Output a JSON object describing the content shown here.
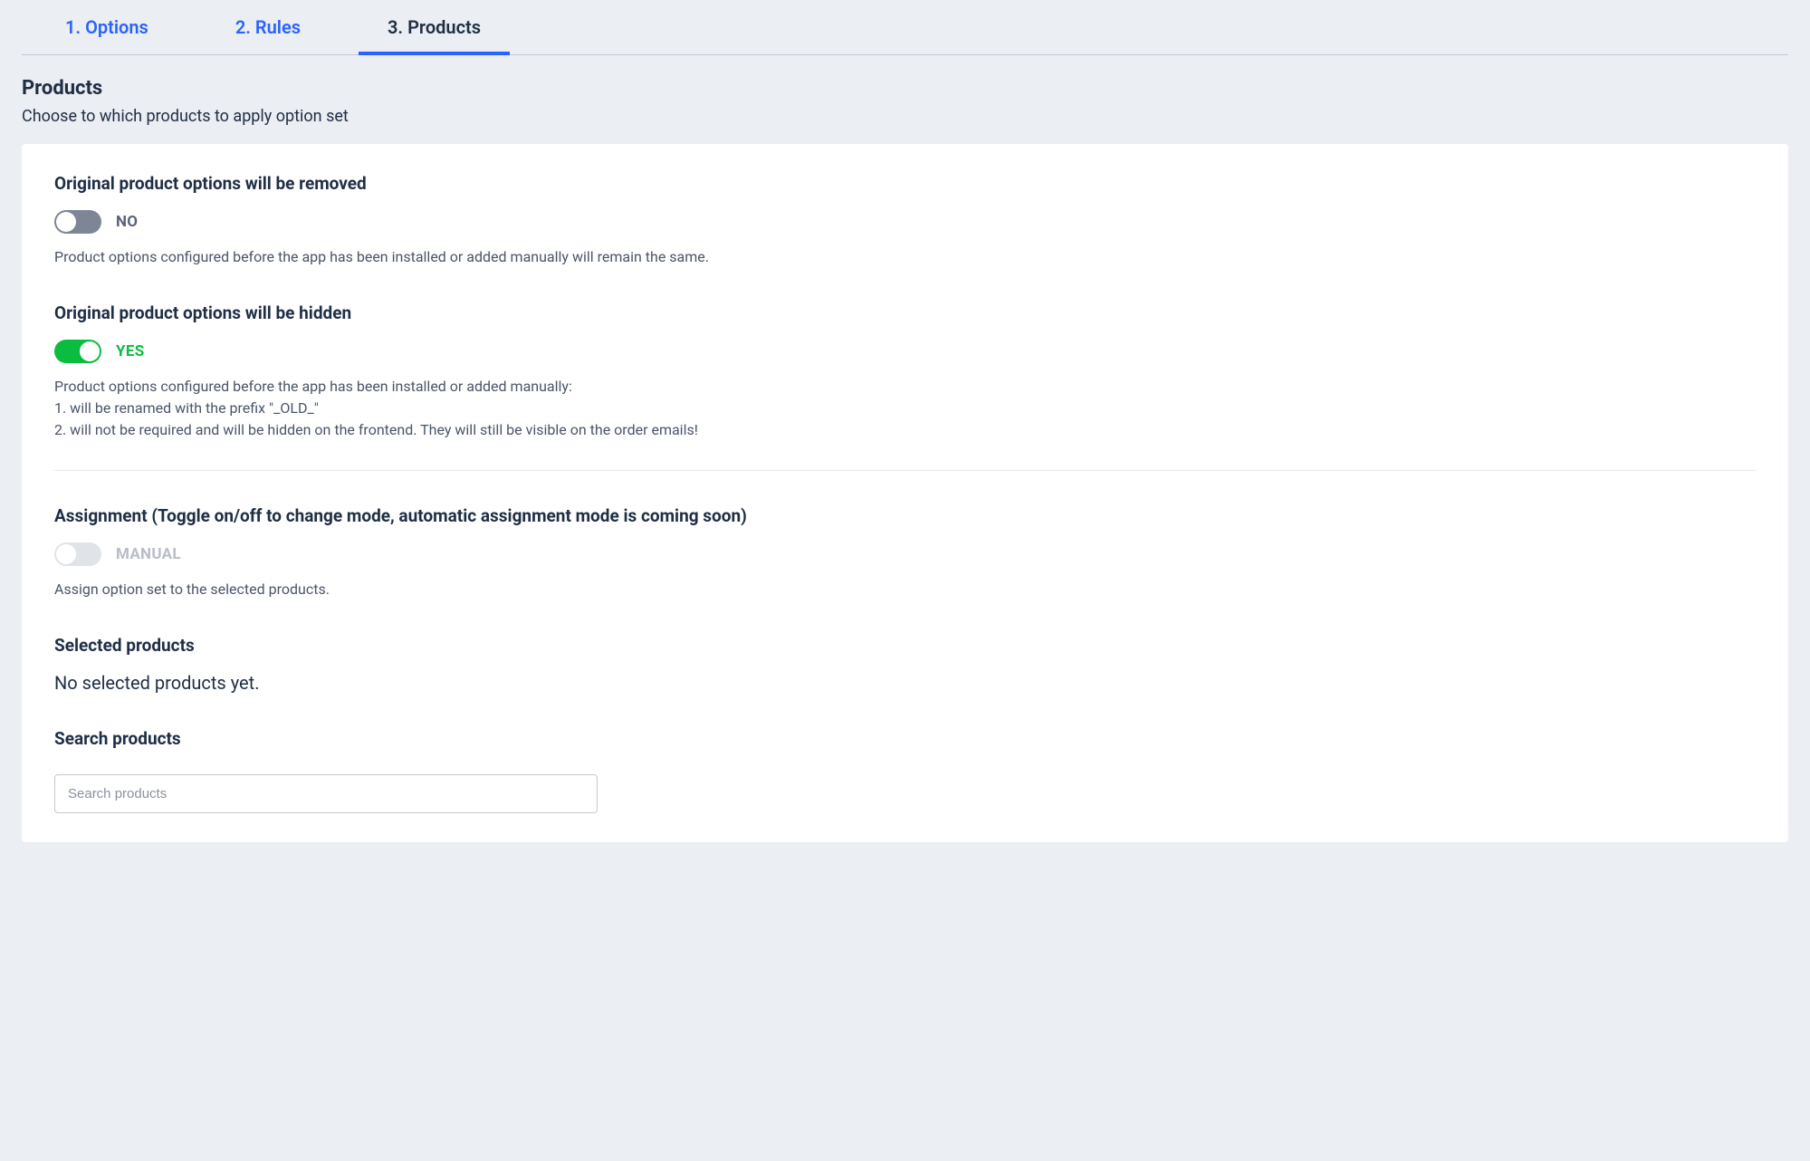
{
  "tabs": [
    {
      "label": "1. Options",
      "active": false
    },
    {
      "label": "2. Rules",
      "active": false
    },
    {
      "label": "3. Products",
      "active": true
    }
  ],
  "page": {
    "title": "Products",
    "subtitle": "Choose to which products to apply option set"
  },
  "sections": {
    "removed": {
      "title": "Original product options will be removed",
      "state_label": "NO",
      "help": "Product options configured before the app has been installed or added manually will remain the same."
    },
    "hidden": {
      "title": "Original product options will be hidden",
      "state_label": "YES",
      "help_intro": "Product options configured before the app has been installed or added manually:",
      "help_1": "1. will be renamed with the prefix \"_OLD_\"",
      "help_2": "2. will not be required and will be hidden on the frontend. They will still be visible on the order emails!"
    },
    "assignment": {
      "title": "Assignment (Toggle on/off to change mode, automatic assignment mode is coming soon)",
      "state_label": "MANUAL",
      "help": "Assign option set to the selected products."
    },
    "selected": {
      "title": "Selected products",
      "empty": "No selected products yet."
    },
    "search": {
      "title": "Search products",
      "placeholder": "Search products"
    }
  }
}
